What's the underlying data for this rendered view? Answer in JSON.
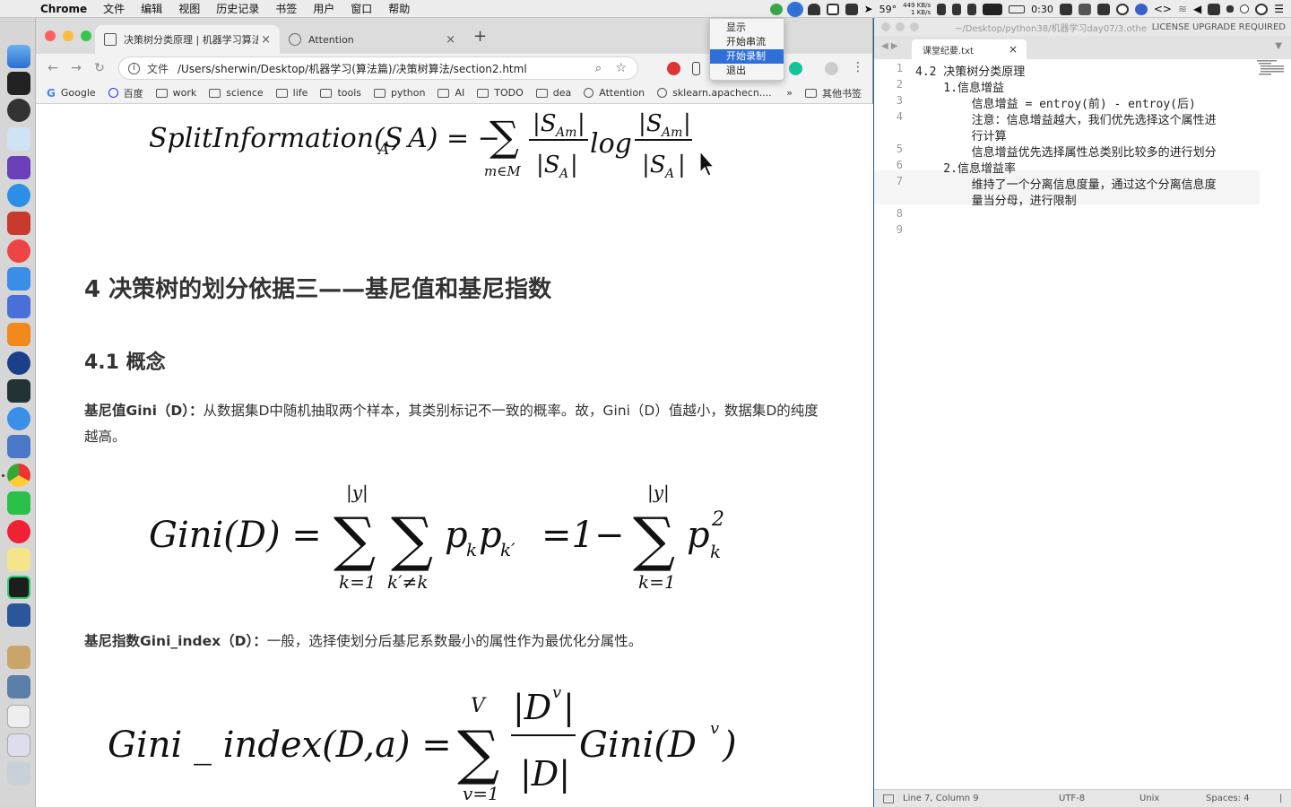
{
  "menubar": {
    "app": "Chrome",
    "menus": [
      "文件",
      "编辑",
      "视图",
      "历史记录",
      "书签",
      "用户",
      "窗口",
      "帮助"
    ],
    "temperature": "59°",
    "net_up": "449 KB/s",
    "net_down": "1 KB/s",
    "battery_time": "0:30"
  },
  "popup_menu": {
    "items": [
      "显示",
      "开始串流",
      "开始录制",
      "退出"
    ],
    "active_index": 2
  },
  "browser": {
    "tabs": [
      {
        "title": "决策树分类原理 | 机器学习算法..."
      },
      {
        "title": "Attention"
      }
    ],
    "address": {
      "scheme_label": "文件",
      "url": "/Users/sherwin/Desktop/机器学习(算法篇)/决策树算法/section2.html"
    },
    "bookmarks": [
      "Google",
      "百度",
      "work",
      "science",
      "life",
      "tools",
      "python",
      "AI",
      "TODO",
      "dea",
      "Attention",
      "sklearn.apachecn...."
    ],
    "bookmarks_more": "»",
    "bookmarks_other": "其他书签"
  },
  "page": {
    "formula_split": "SplitInformation(S_A, A) = −Σ_{m∈M} |S_Am|/|S_A| log |S_Am|/|S_A|",
    "heading_4": "4 决策树的划分依据三——基尼值和基尼指数",
    "heading_41": "4.1 概念",
    "gini_def_bold": "基尼值Gini（D）：",
    "gini_def_text": "从数据集D中随机抽取两个样本，其类别标记不一致的概率。故，Gini（D）值越小，数据集D的纯度越高。",
    "formula_gini": "Gini(D) = Σ_{k=1}^{|y|} Σ_{k'≠k} p_k p_k' = 1 − Σ_{k=1}^{|y|} p_k²",
    "gini_index_bold": "基尼指数Gini_index（D）：",
    "gini_index_text": "一般，选择使划分后基尼系数最小的属性作为最优化分属性。",
    "formula_gini_index": "Gini_index(D,a) = Σ_{v=1}^{V} |D^v|/|D| Gini(D^v)"
  },
  "editor": {
    "title_path": "~/Desktop/python38/机器学习day07/3.othe",
    "license": "LICENSE UPGRADE REQUIRED",
    "tab": "课堂纪要.txt",
    "lines": [
      {
        "n": "1",
        "text": "4.2 决策树分类原理"
      },
      {
        "n": "2",
        "text": "    1.信息增益"
      },
      {
        "n": "3",
        "text": "        信息增益 = entroy(前) - entroy(后)"
      },
      {
        "n": "4",
        "text": "        注意：信息增益越大，我们优先选择这个属性进"
      },
      {
        "n": "",
        "text": "        行计算"
      },
      {
        "n": "5",
        "text": "        信息增益优先选择属性总类别比较多的进行划分"
      },
      {
        "n": "6",
        "text": "    2.信息增益率"
      },
      {
        "n": "7",
        "text": "        维持了一个分离信息度量，通过这个分离信息度"
      },
      {
        "n": "",
        "text": "        量当分母，进行限制"
      },
      {
        "n": "8",
        "text": ""
      },
      {
        "n": "9",
        "text": ""
      }
    ],
    "status": {
      "position": "Line 7, Column 9",
      "encoding": "UTF-8",
      "line_endings": "Unix",
      "indent": "Spaces: 4"
    }
  },
  "colors": {
    "accent_blue": "#2e6fd8",
    "traffic_red": "#fc605c",
    "traffic_yellow": "#fdbc40",
    "traffic_green": "#34c84a"
  }
}
